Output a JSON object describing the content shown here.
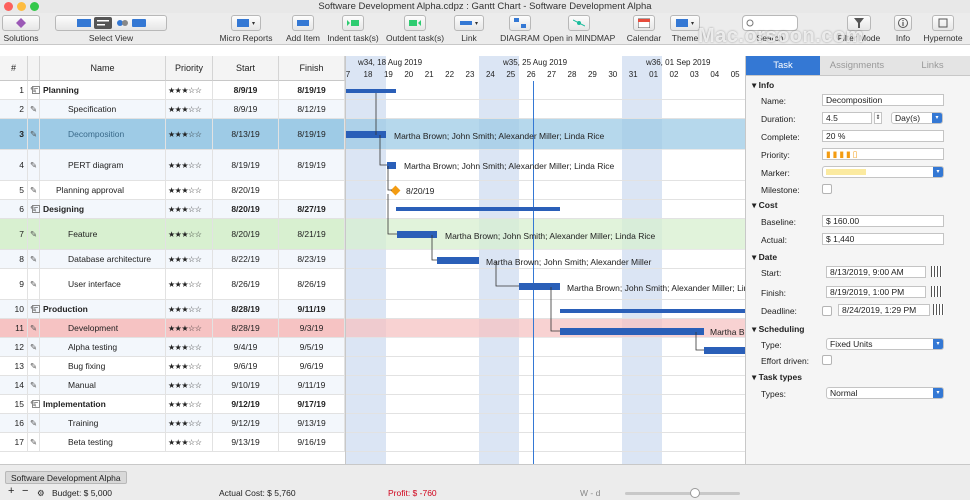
{
  "window": {
    "title": "Software Development Alpha.cdpz : Gantt Chart - Software Development Alpha"
  },
  "toolbar": {
    "solutions": "Solutions",
    "select_view": "Select View",
    "micro_reports": "Micro Reports",
    "add_item": "Add Item",
    "indent": "Indent task(s)",
    "outdent": "Outdent task(s)",
    "link": "Link",
    "diagram": "DIAGRAM",
    "open_mindmap": "Open in MINDMAP",
    "calendar": "Calendar",
    "theme": "Theme",
    "search": "Search",
    "filter_mode": "Filter Mode",
    "info": "Info",
    "hypernote": "Hypernote"
  },
  "watermark": "Mac.orsoon.com",
  "grid": {
    "headers": {
      "num": "#",
      "name": "Name",
      "priority": "Priority",
      "start": "Start",
      "finish": "Finish"
    },
    "rows": [
      {
        "num": "1",
        "name": "Planning",
        "priority": "★★★☆☆",
        "start": "8/9/19",
        "finish": "8/19/19"
      },
      {
        "num": "2",
        "name": "Specification",
        "priority": "★★★☆☆",
        "start": "8/9/19",
        "finish": "8/12/19"
      },
      {
        "num": "3",
        "name": "Decomposition",
        "priority": "★★★☆☆",
        "start": "8/13/19",
        "finish": "8/19/19"
      },
      {
        "num": "4",
        "name": "PERT diagram",
        "priority": "★★★☆☆",
        "start": "8/19/19",
        "finish": "8/19/19"
      },
      {
        "num": "5",
        "name": "Planning approval",
        "priority": "★★★☆☆",
        "start": "8/20/19",
        "finish": ""
      },
      {
        "num": "6",
        "name": "Designing",
        "priority": "★★★☆☆",
        "start": "8/20/19",
        "finish": "8/27/19"
      },
      {
        "num": "7",
        "name": "Feature",
        "priority": "★★★☆☆",
        "start": "8/20/19",
        "finish": "8/21/19"
      },
      {
        "num": "8",
        "name": "Database architecture",
        "priority": "★★★☆☆",
        "start": "8/22/19",
        "finish": "8/23/19"
      },
      {
        "num": "9",
        "name": "User interface",
        "priority": "★★★☆☆",
        "start": "8/26/19",
        "finish": "8/26/19"
      },
      {
        "num": "10",
        "name": "Production",
        "priority": "★★★☆☆",
        "start": "8/28/19",
        "finish": "9/11/19"
      },
      {
        "num": "11",
        "name": "Development",
        "priority": "★★★☆☆",
        "start": "8/28/19",
        "finish": "9/3/19"
      },
      {
        "num": "12",
        "name": "Alpha testing",
        "priority": "★★★☆☆",
        "start": "9/4/19",
        "finish": "9/5/19"
      },
      {
        "num": "13",
        "name": "Bug fixing",
        "priority": "★★★☆☆",
        "start": "9/6/19",
        "finish": "9/6/19"
      },
      {
        "num": "14",
        "name": "Manual",
        "priority": "★★★☆☆",
        "start": "9/10/19",
        "finish": "9/11/19"
      },
      {
        "num": "15",
        "name": "Implementation",
        "priority": "★★★☆☆",
        "start": "9/12/19",
        "finish": "9/17/19"
      },
      {
        "num": "16",
        "name": "Training",
        "priority": "★★★☆☆",
        "start": "9/12/19",
        "finish": "9/13/19"
      },
      {
        "num": "17",
        "name": "Beta testing",
        "priority": "★★★☆☆",
        "start": "9/13/19",
        "finish": "9/16/19"
      }
    ]
  },
  "gantt": {
    "weeks": [
      "w34, 18 Aug 2019",
      "w35, 25 Aug 2019",
      "w36, 01 Sep 2019"
    ],
    "days": [
      "7",
      "18",
      "19",
      "20",
      "21",
      "22",
      "23",
      "24",
      "25",
      "26",
      "27",
      "28",
      "29",
      "30",
      "31",
      "01",
      "02",
      "03",
      "04",
      "05"
    ],
    "labels": {
      "dec": "Martha Brown; John Smith; Alexander Miller; Linda Rice",
      "pert": "Martha Brown; John Smith; Alexander Miller; Linda Rice",
      "approval": "8/20/19",
      "feature": "Martha Brown; John Smith; Alexander Miller; Linda Rice",
      "db": "Martha Brown; John Smith; Alexander Miller",
      "ui": "Martha Brown; John Smith; Alexander Miller; Linda Rice",
      "dev": "Martha B"
    }
  },
  "panel": {
    "tabs": {
      "task": "Task",
      "assignments": "Assignments",
      "links": "Links"
    },
    "info": {
      "section": "Info",
      "name_label": "Name:",
      "name_value": "Decomposition",
      "duration_label": "Duration:",
      "duration_value": "4.5",
      "duration_unit": "Day(s)",
      "complete_label": "Complete:",
      "complete_value": "20 %",
      "priority_label": "Priority:",
      "marker_label": "Marker:",
      "milestone_label": "Milestone:"
    },
    "cost": {
      "section": "Cost",
      "baseline_label": "Baseline:",
      "baseline_value": "$ 160.00",
      "actual_label": "Actual:",
      "actual_value": "$ 1,440"
    },
    "date": {
      "section": "Date",
      "start_label": "Start:",
      "start_date": "8/13/2019,",
      "start_time": "9:00 AM",
      "finish_label": "Finish:",
      "finish_date": "8/19/2019,",
      "finish_time": "1:00 PM",
      "deadline_label": "Deadline:",
      "deadline_date": "8/24/2019,",
      "deadline_time": "1:29 PM"
    },
    "scheduling": {
      "section": "Scheduling",
      "type_label": "Type:",
      "type_value": "Fixed Units",
      "effort_label": "Effort driven:"
    },
    "task_types": {
      "section": "Task types",
      "types_label": "Types:",
      "types_value": "Normal"
    }
  },
  "footer": {
    "sheet_tab": "Software Development Alpha",
    "budget": "Budget: $ 5,000",
    "actual_cost": "Actual Cost: $ 5,760",
    "profit": "Profit: $ -760",
    "zoom": "W - d"
  },
  "colors": {
    "accent": "#3478d4",
    "bar": "#2a5fb8",
    "selected_row": "#9ecbe6",
    "green_row": "#d8f0d0",
    "red_row": "#f6c3c3",
    "profit": "#d0021b",
    "milestone": "#f39c12"
  }
}
